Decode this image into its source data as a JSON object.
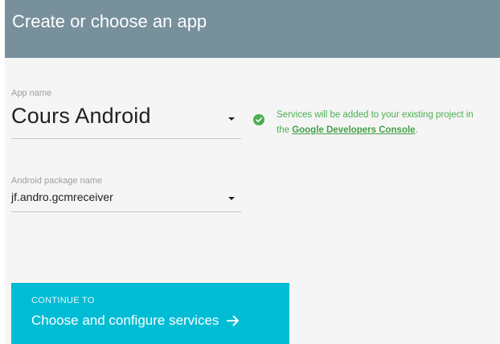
{
  "header": {
    "title": "Create or choose an app"
  },
  "app_name": {
    "label": "App name",
    "value": "Cours Android"
  },
  "package_name": {
    "label": "Android package name",
    "value": "jf.andro.gcmreceiver"
  },
  "status": {
    "line1": "Services will be added to your existing project in",
    "line2_prefix": "the ",
    "link_text": "Google Developers Console",
    "line2_suffix": "."
  },
  "continue_button": {
    "sub_label": "CONTINUE TO",
    "main_label": "Choose and configure services"
  },
  "colors": {
    "header_bg": "#78909c",
    "button_bg": "#00bcd4",
    "success": "#4caf50"
  },
  "icons": {
    "status": "check-circle-icon",
    "dropdown": "dropdown-arrow-icon",
    "continue": "arrow-right-icon"
  }
}
